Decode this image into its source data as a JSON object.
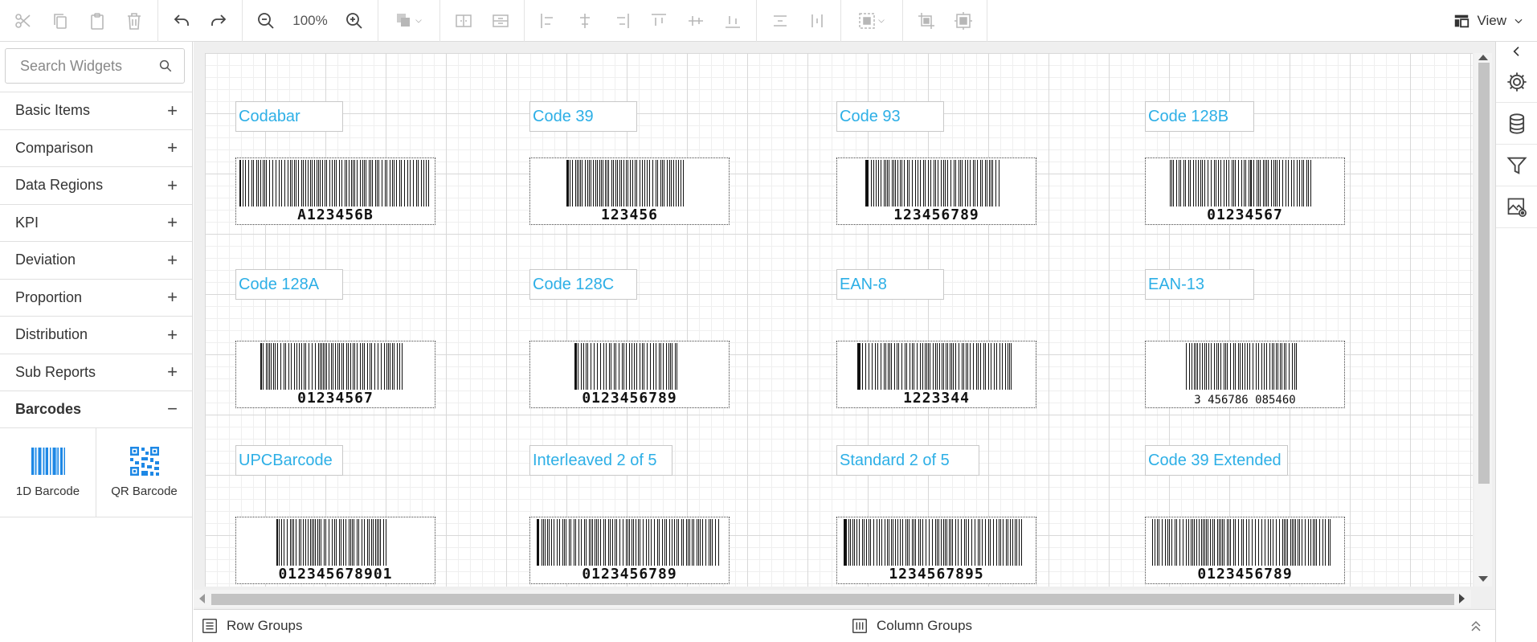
{
  "toolbar": {
    "zoom_value": "100%",
    "view_label": "View"
  },
  "left_panel": {
    "search_placeholder": "Search Widgets",
    "categories": [
      {
        "label": "Basic Items",
        "sign": "+"
      },
      {
        "label": "Comparison",
        "sign": "+"
      },
      {
        "label": "Data Regions",
        "sign": "+"
      },
      {
        "label": "KPI",
        "sign": "+"
      },
      {
        "label": "Deviation",
        "sign": "+"
      },
      {
        "label": "Proportion",
        "sign": "+"
      },
      {
        "label": "Distribution",
        "sign": "+"
      },
      {
        "label": "Sub Reports",
        "sign": "+"
      },
      {
        "label": "Barcodes",
        "sign": "−"
      }
    ],
    "widgets": [
      {
        "label": "1D Barcode",
        "icon": "barcode-1d-icon"
      },
      {
        "label": "QR Barcode",
        "icon": "qr-code-icon"
      }
    ]
  },
  "report": {
    "barcodes": [
      {
        "label": "Codabar",
        "value": "A123456B"
      },
      {
        "label": "Code 39",
        "value": "123456"
      },
      {
        "label": "Code 93",
        "value": "123456789"
      },
      {
        "label": "Code 128B",
        "value": "01234567"
      },
      {
        "label": "Code 128A",
        "value": "01234567"
      },
      {
        "label": "Code 128C",
        "value": "0123456789"
      },
      {
        "label": "EAN-8",
        "value": "1223344"
      },
      {
        "label": "EAN-13",
        "value": "3 456786 085460"
      },
      {
        "label": "UPCBarcode",
        "value": "012345678901"
      },
      {
        "label": "Interleaved 2 of 5",
        "value": "0123456789"
      },
      {
        "label": "Standard 2 of 5",
        "value": "1234567895"
      },
      {
        "label": "Code 39 Extended",
        "value": "0123456789"
      }
    ]
  },
  "groups_bar": {
    "row_groups_label": "Row Groups",
    "column_groups_label": "Column Groups"
  },
  "colors": {
    "accent_label": "#2dafe6",
    "widget_icon": "#1e88e5"
  }
}
